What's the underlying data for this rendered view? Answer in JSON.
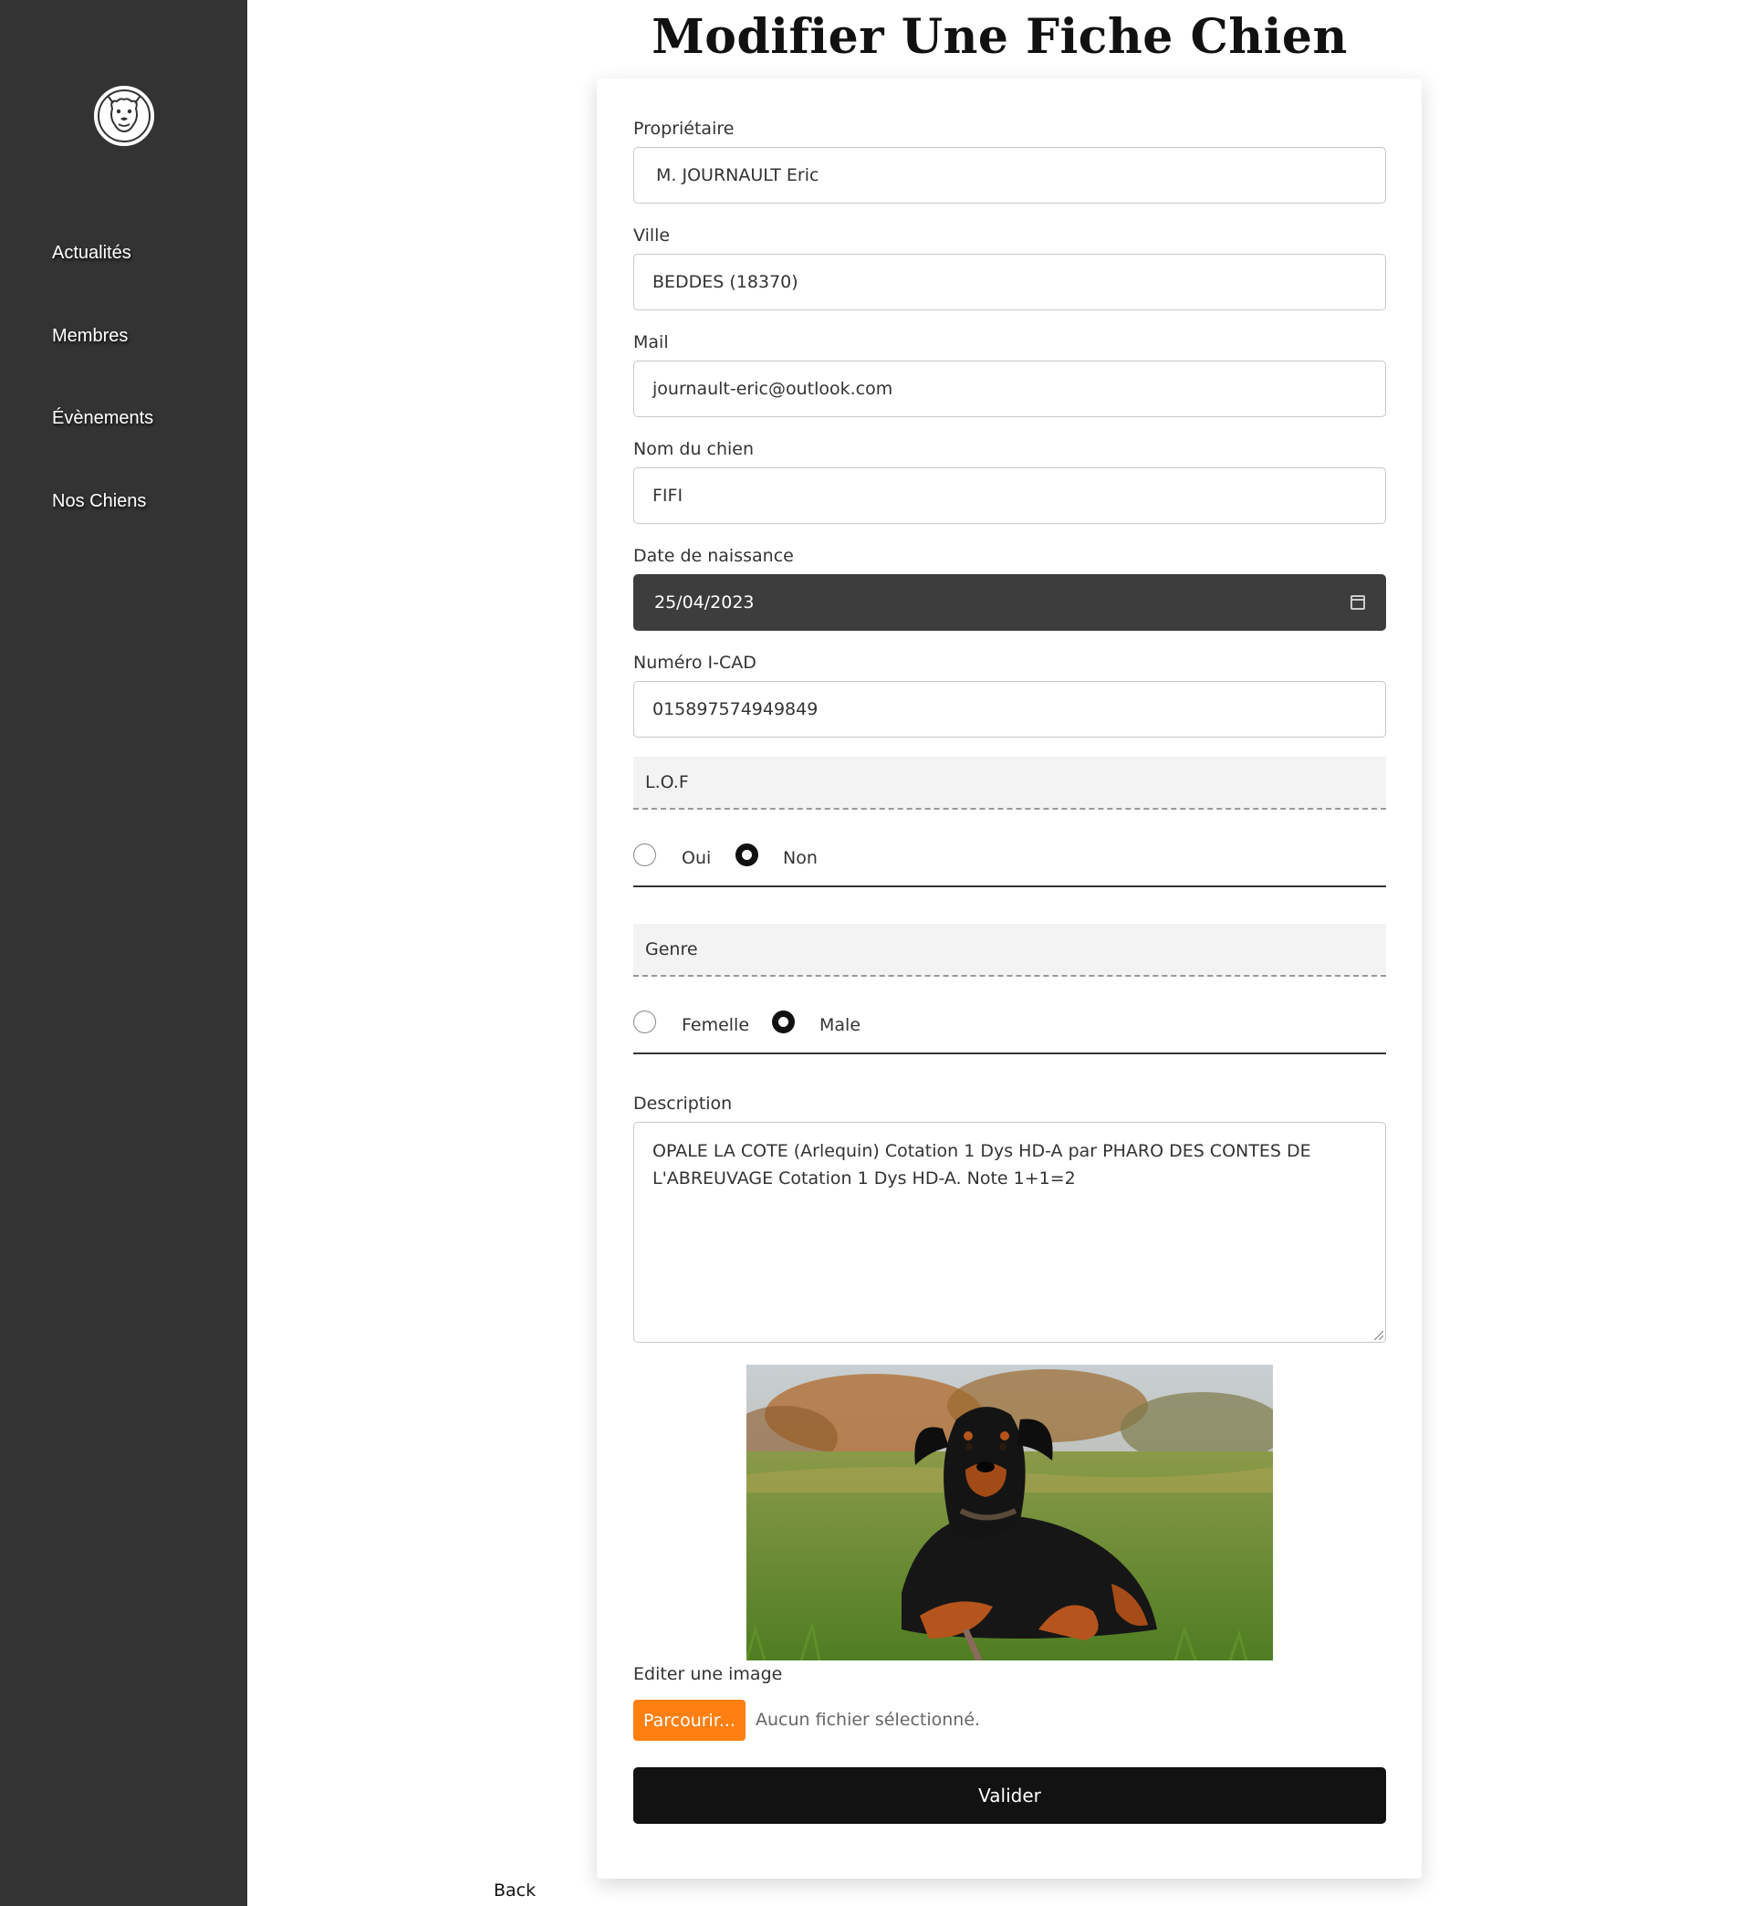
{
  "sidebar": {
    "logo_icon": "dog-face-logo-icon",
    "items": [
      {
        "label": "Actualités"
      },
      {
        "label": "Membres"
      },
      {
        "label": "Évènements"
      },
      {
        "label": "Nos Chiens"
      }
    ]
  },
  "page": {
    "title": "Modifier Une Fiche Chien"
  },
  "form": {
    "owner_label": "Propriétaire",
    "owner_value": "M. JOURNAULT Eric",
    "city_label": "Ville",
    "city_value": "BEDDES (18370)",
    "mail_label": "Mail",
    "mail_value": "journault-eric@outlook.com",
    "dog_name_label": "Nom du chien",
    "dog_name_value": "FIFI",
    "birth_label": "Date de naissance",
    "birth_value": "25/04/2023",
    "icad_label": "Numéro I-CAD",
    "icad_value": "015897574949849",
    "lof": {
      "legend": "L.O.F",
      "options": [
        {
          "label": "Oui",
          "checked": false
        },
        {
          "label": "Non",
          "checked": true
        }
      ]
    },
    "genre": {
      "legend": "Genre",
      "options": [
        {
          "label": "Femelle",
          "checked": false
        },
        {
          "label": "Male",
          "checked": true
        }
      ]
    },
    "description_label": "Description",
    "description_value": "OPALE LA COTE (Arlequin) Cotation 1 Dys HD-A par PHARO DES CONTES DE L'ABREUVAGE Cotation 1 Dys HD-A. Note 1+1=2",
    "image_label": "Editer une image",
    "browse_label": "Parcourir...",
    "no_file_text": "Aucun fichier sélectionné.",
    "submit_label": "Valider"
  },
  "back_label": "Back",
  "colors": {
    "sidebar_bg": "#333333",
    "accent_orange": "#ff7f11",
    "submit_bg": "#121212",
    "date_field_bg": "#3d3d3d"
  }
}
